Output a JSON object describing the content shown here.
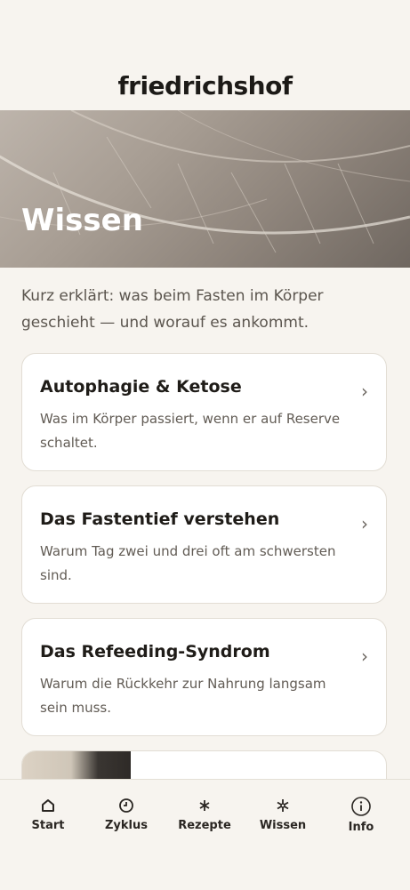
{
  "brand": {
    "logo_text": "friedrichshof"
  },
  "hero": {
    "title": "Wissen"
  },
  "intro": "Kurz erklärt: was beim Fasten im Körper geschieht — und worauf es ankommt.",
  "cards": [
    {
      "title": "Autophagie & Ketose",
      "desc": "Was im Körper passiert, wenn er auf Reserve schaltet.",
      "chevron": "›"
    },
    {
      "title": "Das Fastentief verstehen",
      "desc": "Warum Tag zwei und drei oft am schwersten sind.",
      "chevron": "›"
    },
    {
      "title": "Das Refeeding-Syndrom",
      "desc": "Warum die Rückkehr zur Nahrung langsam sein muss.",
      "chevron": "›"
    }
  ],
  "nav": {
    "items": [
      {
        "label": "Start",
        "icon": "home-icon"
      },
      {
        "label": "Zyklus",
        "icon": "clock-icon"
      },
      {
        "label": "Rezepte",
        "icon": "asterisk-icon"
      },
      {
        "label": "Wissen",
        "icon": "snowflake-icon",
        "active": true
      },
      {
        "label": "Info",
        "icon": "info-icon"
      }
    ]
  }
}
